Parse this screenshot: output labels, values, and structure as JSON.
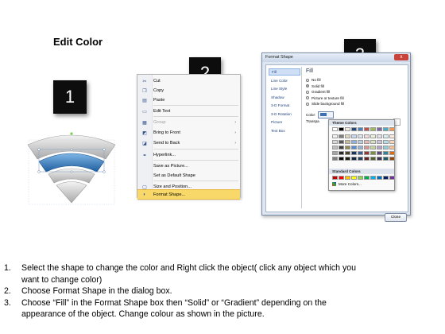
{
  "title": "Edit Color",
  "badges": [
    "1",
    "2",
    "3"
  ],
  "colors": {
    "badge_bg": "#0d0d0d",
    "highlight": "#f9d86a",
    "selected_band": "#2f7dc2",
    "gray_band": "#bdbdbd"
  },
  "context_menu": {
    "items": [
      {
        "label": "Cut",
        "icon": "scissors-icon",
        "disabled": false,
        "submenu": false
      },
      {
        "label": "Copy",
        "icon": "copy-icon",
        "disabled": false,
        "submenu": false
      },
      {
        "label": "Paste",
        "icon": "paste-icon",
        "disabled": false,
        "submenu": false
      },
      {
        "label": "Edit Text",
        "icon": "edit-text-icon",
        "disabled": false,
        "submenu": false
      },
      {
        "label": "Group",
        "icon": "group-icon",
        "disabled": true,
        "submenu": true
      },
      {
        "label": "Bring to Front",
        "icon": "bring-front-icon",
        "disabled": false,
        "submenu": true
      },
      {
        "label": "Send to Back",
        "icon": "send-back-icon",
        "disabled": false,
        "submenu": true
      },
      {
        "label": "Hyperlink...",
        "icon": "hyperlink-icon",
        "disabled": false,
        "submenu": false
      },
      {
        "label": "Save as Picture...",
        "icon": "",
        "disabled": false,
        "submenu": false
      },
      {
        "label": "Set as Default Shape",
        "icon": "",
        "disabled": false,
        "submenu": false
      },
      {
        "label": "Size and Position...",
        "icon": "size-icon",
        "disabled": false,
        "submenu": false
      },
      {
        "label": "Format Shape...",
        "icon": "format-shape-icon",
        "disabled": false,
        "submenu": false,
        "highlighted": true
      }
    ],
    "arrow": "›"
  },
  "dialog": {
    "title": "Format Shape",
    "close_glyph": "x",
    "nav": [
      "Fill",
      "Line Color",
      "Line Style",
      "Shadow",
      "3-D Format",
      "3-D Rotation",
      "Picture",
      "Text Box"
    ],
    "selected_nav": "Fill",
    "section": "Fill",
    "fill_options": [
      {
        "label": "No fill",
        "checked": false
      },
      {
        "label": "Solid fill",
        "checked": true
      },
      {
        "label": "Gradient fill",
        "checked": false
      },
      {
        "label": "Picture or texture fill",
        "checked": false
      },
      {
        "label": "Slide background fill",
        "checked": false
      }
    ],
    "color_label": "Color:",
    "transparency_label": "Transpa",
    "palette": {
      "theme_header": "Theme Colors",
      "theme_rows": [
        [
          "#ffffff",
          "#000000",
          "#eeece1",
          "#1f497d",
          "#4f81bd",
          "#c0504d",
          "#9bbb59",
          "#8064a2",
          "#4bacc6",
          "#f79646"
        ],
        [
          "#f2f2f2",
          "#7f7f7f",
          "#ddd9c3",
          "#c6d9f0",
          "#dbe5f1",
          "#f2dcdb",
          "#ebf1dd",
          "#e5e0ec",
          "#dbeef3",
          "#fdeada"
        ],
        [
          "#d8d8d8",
          "#595959",
          "#c4bd97",
          "#8db3e2",
          "#b8cce4",
          "#e5b9b7",
          "#d7e3bc",
          "#ccc1d9",
          "#b7dde8",
          "#fbd5b5"
        ],
        [
          "#bfbfbf",
          "#3f3f3f",
          "#938953",
          "#548dd4",
          "#95b3d7",
          "#d99694",
          "#c3d69b",
          "#b2a2c7",
          "#92cddc",
          "#fac08f"
        ],
        [
          "#a5a5a5",
          "#262626",
          "#494429",
          "#17365d",
          "#366092",
          "#953734",
          "#76923c",
          "#5f497a",
          "#31859b",
          "#e36c09"
        ],
        [
          "#7f7f7f",
          "#0c0c0c",
          "#1d1b10",
          "#0f243e",
          "#244061",
          "#632423",
          "#4f6128",
          "#3f3151",
          "#205867",
          "#974806"
        ]
      ],
      "standard_header": "Standard Colors",
      "standard_row": [
        "#c00000",
        "#ff0000",
        "#ffc000",
        "#ffff00",
        "#92d050",
        "#00b050",
        "#00b0f0",
        "#0070c0",
        "#002060",
        "#7030a0"
      ],
      "more_label": "More Colors..."
    },
    "close_button": "Close"
  },
  "instructions": [
    {
      "n": "1.",
      "lines": [
        "Select the shape to change the color and Right click the object( click any object which you",
        "want to change color)"
      ]
    },
    {
      "n": "2.",
      "lines": [
        "Choose Format Shape in the dialog box."
      ]
    },
    {
      "n": "3.",
      "lines": [
        "Choose “Fill” in the Format Shape box then “Solid” or “Gradient” depending on the",
        "appearance of the object. Change colour as shown in the picture."
      ]
    }
  ]
}
